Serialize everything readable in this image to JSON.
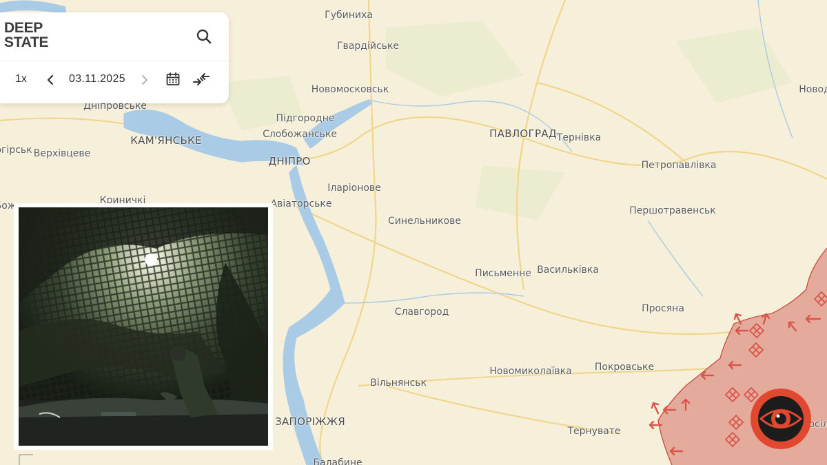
{
  "app": {
    "brand_line1": "DEEP",
    "brand_line2": "STATE"
  },
  "controls": {
    "speed": "1x",
    "date": "03.11.2025"
  },
  "colors": {
    "map_bg": "#f6efd9",
    "water": "#a9cbe6",
    "occupied": "#e2a396",
    "occupied_border": "#c94a3e",
    "arrow": "#d9544a",
    "road": "#f2d58d",
    "eye_ring": "#e0492f"
  },
  "icons": [
    "search-icon",
    "chevron-left-icon",
    "chevron-right-icon",
    "calendar-icon",
    "compare-arrows-icon",
    "eye-logo-icon"
  ],
  "places": [
    {
      "id": "gubynykha",
      "name": "Губиниха",
      "cls": "town"
    },
    {
      "id": "gvardiiske",
      "name": "Гвардійське",
      "cls": "town"
    },
    {
      "id": "novomoskovsk",
      "name": "Новомосковськ",
      "cls": "town"
    },
    {
      "id": "dniprovske",
      "name": "Дніпровське",
      "cls": "town"
    },
    {
      "id": "pidhorodne",
      "name": "Підгородне",
      "cls": "town"
    },
    {
      "id": "slobozhanske",
      "name": "Слобожанське",
      "cls": "town"
    },
    {
      "id": "kamianske",
      "name": "КАМ'ЯНСЬКЕ",
      "cls": "city"
    },
    {
      "id": "dnipro",
      "name": "ДНІПРО",
      "cls": "city"
    },
    {
      "id": "girsk",
      "name": "огірськ",
      "cls": "town"
    },
    {
      "id": "verkhivtseve",
      "name": "Верхівцеве",
      "cls": "town"
    },
    {
      "id": "kynychky",
      "name": "Криничкі",
      "cls": "town"
    },
    {
      "id": "bozh",
      "name": "Бож",
      "cls": "town"
    },
    {
      "id": "aviatorske",
      "name": "Авіаторське",
      "cls": "town"
    },
    {
      "id": "ilarionove",
      "name": "Іларіонове",
      "cls": "town"
    },
    {
      "id": "pavlohrad",
      "name": "ПАВЛОГРАД",
      "cls": "city"
    },
    {
      "id": "ternivka",
      "name": "Тернівка",
      "cls": "town"
    },
    {
      "id": "novod",
      "name": "Новод",
      "cls": "town"
    },
    {
      "id": "petropavlivka",
      "name": "Петропавлівка",
      "cls": "town"
    },
    {
      "id": "pershotravensk",
      "name": "Першотравенськ",
      "cls": "town"
    },
    {
      "id": "synelnykove",
      "name": "Синельникове",
      "cls": "town"
    },
    {
      "id": "pysmenne",
      "name": "Письменне",
      "cls": "town"
    },
    {
      "id": "vasylkivka",
      "name": "Васильківка",
      "cls": "town"
    },
    {
      "id": "slavhorod",
      "name": "Славгород",
      "cls": "town"
    },
    {
      "id": "prosiana",
      "name": "Просяна",
      "cls": "town"
    },
    {
      "id": "novomykolaivka",
      "name": "Новомиколаївка",
      "cls": "town"
    },
    {
      "id": "pokrovske",
      "name": "Покровське",
      "cls": "town"
    },
    {
      "id": "vilniansk",
      "name": "Вільнянськ",
      "cls": "town"
    },
    {
      "id": "zaporizhzhia",
      "name": "ЗАПОРІЖЖЯ",
      "cls": "city"
    },
    {
      "id": "ternuvate",
      "name": "Тернувате",
      "cls": "town"
    },
    {
      "id": "babyne",
      "name": "Балабине",
      "cls": "town"
    },
    {
      "id": "rosil",
      "name": "осіл",
      "cls": "town"
    }
  ]
}
